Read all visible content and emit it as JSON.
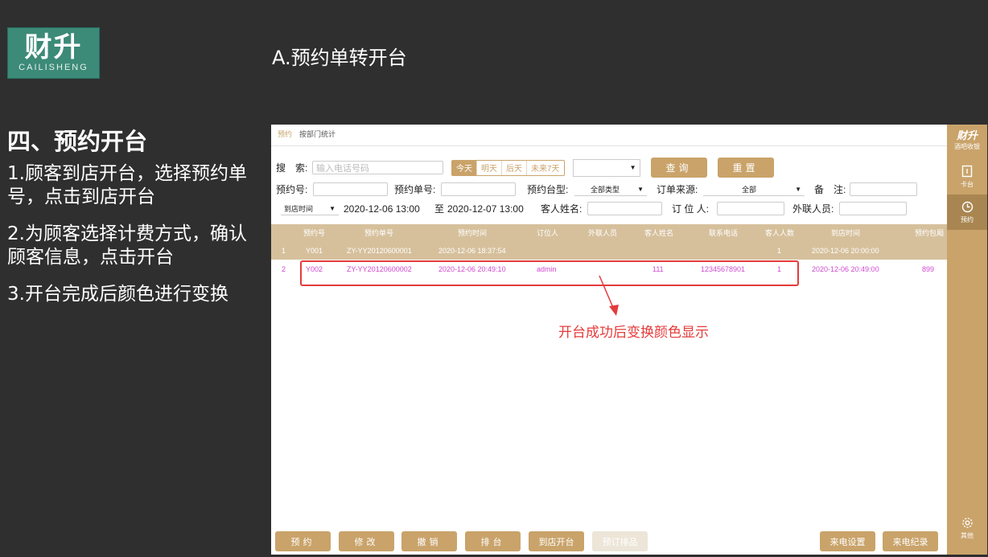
{
  "logo": {
    "main": "财升",
    "sub": "CAILISHENG"
  },
  "slide_title": "A.预约单转开台",
  "left": {
    "heading": "四、预约开台",
    "steps": [
      "1.顾客到店开台，选择预约单号，点击到店开台",
      "2.为顾客选择计费方式，确认顾客信息，点击开台",
      "3.开台完成后颜色进行变换"
    ]
  },
  "tabs": [
    "预约",
    "按部门统计"
  ],
  "search": {
    "label": "搜　索:",
    "placeholder": "输入电话号码",
    "dates": [
      "今天",
      "明天",
      "后天",
      "未来7天"
    ],
    "query_label": "查询",
    "reset_label": "重置"
  },
  "filters": {
    "resv_no_label": "预约号:",
    "resv_order_label": "预约单号:",
    "table_type_label": "预约台型:",
    "table_type_value": "全部类型",
    "source_label": "订单来源:",
    "source_value": "全部",
    "note_label": "备　注:",
    "time_type": "到店时间",
    "from": "2020-12-06 13:00",
    "to_label": "至",
    "to": "2020-12-07 13:00",
    "guest_label": "客人姓名:",
    "booker_label": "订 位 人:",
    "liaison_label": "外联人员:"
  },
  "table": {
    "headers": [
      "预约号",
      "预约单号",
      "预约时间",
      "订位人",
      "外联人员",
      "客人姓名",
      "联系电话",
      "客人人数",
      "到店时间",
      "预约包厢"
    ],
    "rows": [
      {
        "idx": "1",
        "no": "Y001",
        "order": "ZY-YY20120600001",
        "time": "2020-12-06 18:37:54",
        "booker": "",
        "liaison": "",
        "guest": "",
        "phone": "",
        "count": "1",
        "arrive": "2020-12-06 20:00:00",
        "room": ""
      },
      {
        "idx": "2",
        "no": "Y002",
        "order": "ZY-YY20120600002",
        "time": "2020-12-06 20:49:10",
        "booker": "admin",
        "liaison": "",
        "guest": "111",
        "phone": "12345678901",
        "count": "1",
        "arrive": "2020-12-06 20:49:00",
        "room": "899"
      }
    ]
  },
  "annotation": "开台成功后变换颜色显示",
  "bottom_buttons": [
    "预约",
    "修改",
    "撤销",
    "排台",
    "到店开台",
    "预订排品",
    "来电设置",
    "来电纪录"
  ],
  "sidebar": {
    "brand": "财升",
    "brand_sub": "酒吧收银",
    "items": [
      "卡台",
      "预约",
      "其他"
    ]
  },
  "colors": {
    "accent": "#c9a36a",
    "highlight_text": "#d04ad0",
    "annotation": "#e53b3b",
    "background": "#2f2f2f"
  }
}
